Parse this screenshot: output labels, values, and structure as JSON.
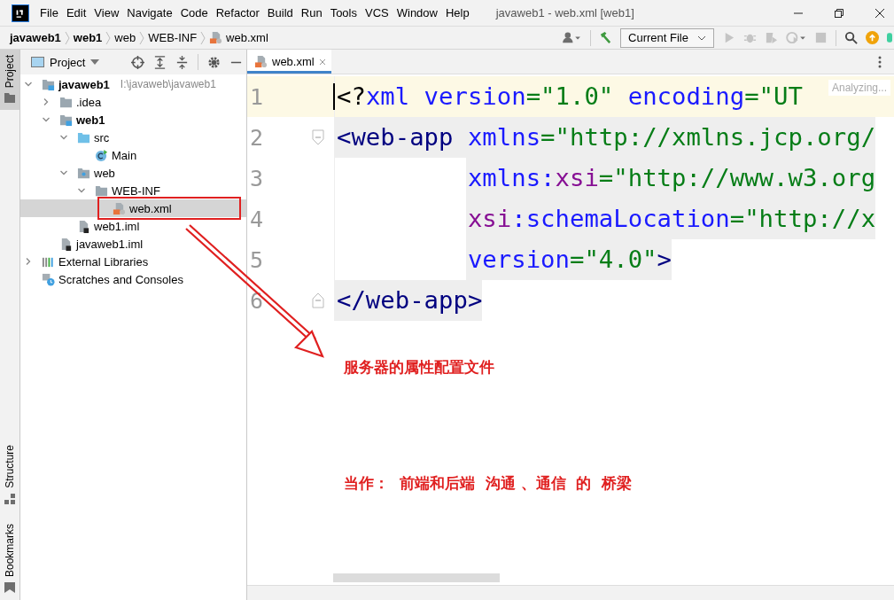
{
  "window": {
    "title": "javaweb1 - web.xml [web1]"
  },
  "menu": [
    "File",
    "Edit",
    "View",
    "Navigate",
    "Code",
    "Refactor",
    "Build",
    "Run",
    "Tools",
    "VCS",
    "Window",
    "Help"
  ],
  "breadcrumbs": [
    {
      "label": "javaweb1",
      "bold": true
    },
    {
      "label": "web1",
      "bold": true
    },
    {
      "label": "web",
      "bold": false
    },
    {
      "label": "WEB-INF",
      "bold": false
    },
    {
      "label": "web.xml",
      "bold": false
    }
  ],
  "run_config": {
    "label": "Current File"
  },
  "tool_window_tabs": [
    {
      "label": "Project",
      "selected": true
    },
    {
      "label": "Structure",
      "selected": false
    },
    {
      "label": "Bookmarks",
      "selected": false
    }
  ],
  "project_panel": {
    "title": "Project",
    "tree": [
      {
        "name": "javaweb1",
        "kind": "module",
        "bold": true,
        "hint": "I:\\javaweb\\javaweb1",
        "expanded": true,
        "selected": false,
        "children": [
          {
            "name": ".idea",
            "kind": "folder",
            "bold": false,
            "expanded": false,
            "selected": false
          },
          {
            "name": "web1",
            "kind": "module",
            "bold": true,
            "expanded": true,
            "selected": false,
            "children": [
              {
                "name": "src",
                "kind": "source-folder",
                "bold": false,
                "expanded": true,
                "selected": false,
                "children": [
                  {
                    "name": "Main",
                    "kind": "class",
                    "bold": false,
                    "selected": false
                  }
                ]
              },
              {
                "name": "web",
                "kind": "web-folder",
                "bold": false,
                "expanded": true,
                "selected": false,
                "children": [
                  {
                    "name": "WEB-INF",
                    "kind": "folder",
                    "bold": false,
                    "expanded": true,
                    "selected": false,
                    "children": [
                      {
                        "name": "web.xml",
                        "kind": "xml",
                        "bold": false,
                        "selected": true
                      }
                    ]
                  }
                ]
              },
              {
                "name": "web1.iml",
                "kind": "iml",
                "bold": false,
                "selected": false
              }
            ]
          },
          {
            "name": "javaweb1.iml",
            "kind": "iml",
            "bold": false,
            "selected": false
          }
        ]
      },
      {
        "name": "External Libraries",
        "kind": "libraries",
        "bold": false,
        "expanded": false,
        "selected": false
      },
      {
        "name": "Scratches and Consoles",
        "kind": "scratches",
        "bold": false,
        "selected": false
      }
    ]
  },
  "editor": {
    "tabs": [
      {
        "label": "web.xml",
        "selected": true
      }
    ],
    "status_hint": "Analyzing...",
    "lines": [
      {
        "number": "1",
        "current": true,
        "fold": false,
        "indent": false,
        "segments": [
          {
            "kind": "punct",
            "text": "<?"
          },
          {
            "kind": "attr",
            "text": "xml version"
          },
          {
            "kind": "value",
            "text": "=\"1.0\""
          },
          {
            "kind": "attr",
            "text": " encoding"
          },
          {
            "kind": "value",
            "text": "=\"UT"
          }
        ]
      },
      {
        "number": "2",
        "current": false,
        "fold": true,
        "indent": false,
        "segments": [
          {
            "kind": "tag",
            "text": "<web-app"
          },
          {
            "kind": "attr",
            "text": " xmlns"
          },
          {
            "kind": "value",
            "text": "=\"http://xmlns.jcp.org/"
          }
        ]
      },
      {
        "number": "3",
        "current": false,
        "fold": false,
        "indent": true,
        "segments": [
          {
            "kind": "attr",
            "text": "xmlns:"
          },
          {
            "kind": "ns",
            "text": "xsi"
          },
          {
            "kind": "value",
            "text": "=\"http://www.w3.org"
          }
        ]
      },
      {
        "number": "4",
        "current": false,
        "fold": false,
        "indent": true,
        "segments": [
          {
            "kind": "ns",
            "text": "xsi"
          },
          {
            "kind": "attr",
            "text": ":schemaLocation"
          },
          {
            "kind": "value",
            "text": "=\"http://x"
          }
        ]
      },
      {
        "number": "5",
        "current": false,
        "fold": false,
        "indent": true,
        "segments": [
          {
            "kind": "attr",
            "text": "version"
          },
          {
            "kind": "value",
            "text": "=\"4.0\""
          },
          {
            "kind": "tag",
            "text": ">"
          }
        ]
      },
      {
        "number": "6",
        "current": false,
        "fold": true,
        "indent": false,
        "segments": [
          {
            "kind": "tag",
            "text": "</web-app>"
          }
        ]
      }
    ]
  },
  "annotations": [
    {
      "text": "服务器的属性配置文件"
    },
    {
      "text": "当作：  前端和后端  沟通 、通信  的  桥梁"
    }
  ]
}
